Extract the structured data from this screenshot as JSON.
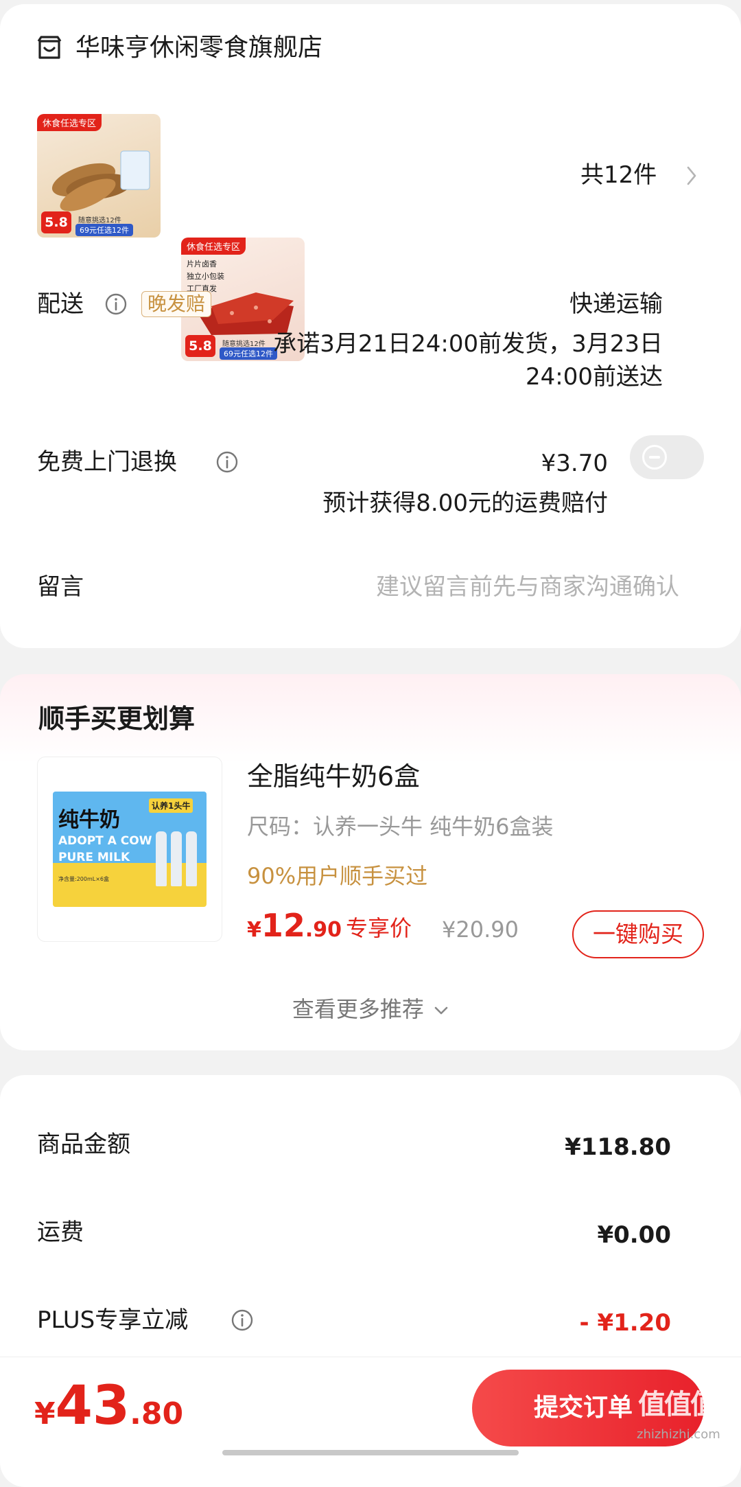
{
  "shop": {
    "name": "华味亨休闲零食旗舰店",
    "item_count": "共12件",
    "products": [
      {
        "tag": "休食任选专区",
        "price": "5.8",
        "promo": "69元任选12件",
        "sub": "随意挑选12件"
      },
      {
        "tag": "休食任选专区",
        "price": "5.8",
        "promo": "69元任选12件",
        "sub": "随意挑选12件",
        "lines": [
          "片片卤香",
          "独立小包装",
          "工厂直发"
        ]
      }
    ]
  },
  "delivery": {
    "label": "配送",
    "badge": "晚发赔",
    "method": "快递运输",
    "promise_line1": "承诺3月21日24:00前发货，3月23日",
    "promise_line2": "24:00前送达"
  },
  "return_service": {
    "label": "免费上门退换",
    "price": "¥3.70",
    "note": "预计获得8.00元的运费赔付",
    "enabled": false
  },
  "message": {
    "label": "留言",
    "placeholder": "建议留言前先与商家沟通确认"
  },
  "recommend": {
    "title": "顺手买更划算",
    "product": {
      "name": "全脂纯牛奶6盒",
      "spec": "尺码：认养一头牛 纯牛奶6盒装",
      "social_proof": "90%用户顺手买过",
      "price_symbol": "¥",
      "price_int": "12",
      "price_dec": ".90",
      "price_tag": "专享价",
      "original_price": "¥20.90",
      "buy_label": "一键购买",
      "image_text_cn": "纯牛奶",
      "image_text_en1": "ADOPT A COW",
      "image_text_en2": "PURE MILK",
      "image_brand": "认养1头牛",
      "image_volume": "净含量:200mL×6盒"
    },
    "more_label": "查看更多推荐"
  },
  "summary": {
    "rows": [
      {
        "label": "商品金额",
        "value": "¥118.80"
      },
      {
        "label": "运费",
        "value": "¥0.00"
      },
      {
        "label": "PLUS专享立减",
        "value": "- ¥1.20"
      }
    ]
  },
  "footer": {
    "currency": "¥",
    "total_int": "43",
    "total_dec": ".80",
    "submit_label": "提交订单",
    "watermark": "值值值",
    "watermark_url": "zhizhizhi.com"
  },
  "colors": {
    "accent": "#e2231a",
    "badge": "#c7913f",
    "muted": "#999999"
  }
}
